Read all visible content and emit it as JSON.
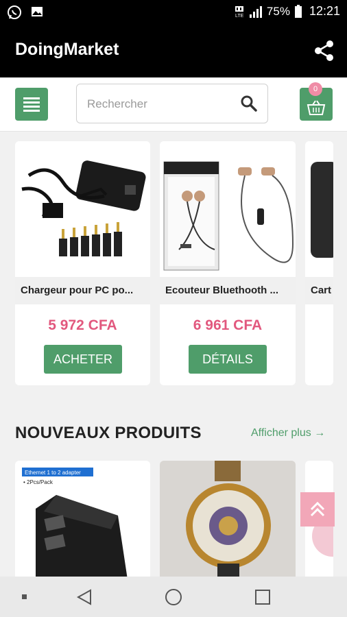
{
  "status_bar": {
    "battery": "75%",
    "time": "12:21",
    "network_label": "LTE"
  },
  "app_bar": {
    "title": "DoingMarket",
    "share_icon": "share-icon"
  },
  "toolbar": {
    "menu_icon": "menu-icon",
    "search_placeholder": "Rechercher",
    "search_icon": "search-icon",
    "cart_count": "0",
    "cart_icon": "basket-icon"
  },
  "featured_products": [
    {
      "name": "Chargeur pour PC po...",
      "price": "5 972 CFA",
      "action": "ACHETER"
    },
    {
      "name": "Ecouteur Bluethooth ...",
      "price": "6 961 CFA",
      "action": "DÉTAILS"
    },
    {
      "name": "Cart",
      "price": "",
      "action": ""
    }
  ],
  "new_products": {
    "title": "NOUVEAUX PRODUITS",
    "see_more": "Afficher plus →",
    "items": [
      {
        "image": "ethernet-adapter",
        "tag": "Ethernet 1 to 2 adapter",
        "sub": "• 2Pcs/Pack"
      },
      {
        "image": "gold-watch"
      },
      {
        "image": "pink-product"
      }
    ]
  },
  "colors": {
    "accent": "#4f9d6a",
    "price": "#e2587e",
    "badge": "#ef8ca6",
    "appbar": "#000000"
  }
}
